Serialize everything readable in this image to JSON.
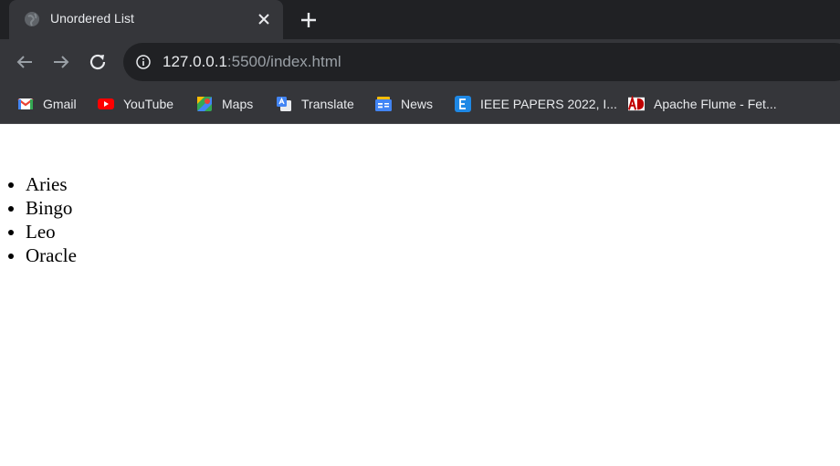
{
  "tab": {
    "title": "Unordered List"
  },
  "address_bar": {
    "host": "127.0.0.1",
    "path": ":5500/index.html"
  },
  "bookmarks": [
    {
      "label": "Gmail",
      "icon": "gmail-icon"
    },
    {
      "label": "YouTube",
      "icon": "youtube-icon"
    },
    {
      "label": "Maps",
      "icon": "maps-icon"
    },
    {
      "label": "Translate",
      "icon": "translate-icon"
    },
    {
      "label": "News",
      "icon": "news-icon"
    },
    {
      "label": "IEEE PAPERS 2022, I...",
      "icon": "e-icon"
    },
    {
      "label": "Apache Flume - Fet...",
      "icon": "ad-icon"
    }
  ],
  "page": {
    "list_items": [
      "Aries",
      "Bingo",
      "Leo",
      "Oracle"
    ]
  },
  "colors": {
    "tabstrip": "#202124",
    "toolbar": "#35363a",
    "page_background": "#ffffff"
  }
}
